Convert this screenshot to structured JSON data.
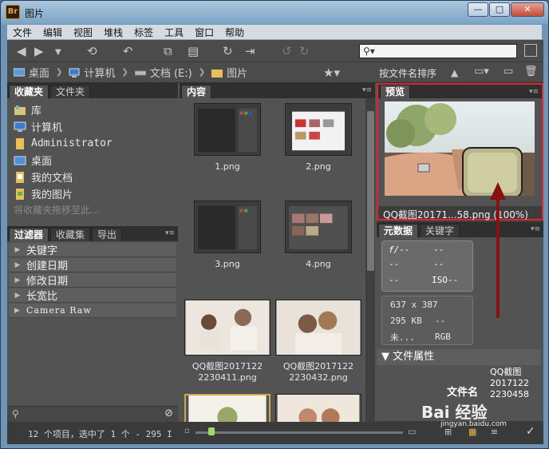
{
  "window": {
    "app_icon_text": "Br",
    "title": "图片",
    "min": "—",
    "max": "□",
    "close": "✕"
  },
  "menu": [
    "文件",
    "编辑",
    "视图",
    "堆栈",
    "标签",
    "工具",
    "窗口",
    "帮助"
  ],
  "search": {
    "placeholder": "",
    "icon": "search-icon"
  },
  "breadcrumb": [
    "桌面",
    "计算机",
    "文档 (E:)",
    "图片"
  ],
  "sort_label": "按文件名排序",
  "left_tabs": [
    "收藏夹",
    "文件夹"
  ],
  "favorites": [
    {
      "label": "库",
      "icon": "library-icon"
    },
    {
      "label": "计算机",
      "icon": "computer-icon"
    },
    {
      "label": "Administrator",
      "icon": "folder-icon"
    },
    {
      "label": "桌面",
      "icon": "desktop-icon"
    },
    {
      "label": "我的文档",
      "icon": "documents-icon"
    },
    {
      "label": "我的图片",
      "icon": "pictures-icon"
    }
  ],
  "favorites_hint": "将收藏夹拖移至此...",
  "filter_tabs": [
    "过滤器",
    "收藏集",
    "导出"
  ],
  "filters": [
    "关键字",
    "创建日期",
    "修改日期",
    "长宽比",
    "Camera Raw"
  ],
  "content_tab": "内容",
  "thumbnails": [
    {
      "label": "1.png"
    },
    {
      "label": "2.png"
    },
    {
      "label": "3.png"
    },
    {
      "label": "4.png"
    },
    {
      "label": "QQ截图2017122\n2230411.png"
    },
    {
      "label": "QQ截图2017122\n2230432.png"
    }
  ],
  "preview_tab": "预览",
  "preview_caption": "QQ截图20171...58.png (100%)",
  "meta_tabs": [
    "元数据",
    "关键字"
  ],
  "camera": {
    "aperture": "f/--",
    "a2": "--",
    "a3": "--",
    "a4": "--",
    "a5": "--",
    "iso": "ISO--"
  },
  "info": {
    "dims": "637 x 387",
    "size": "295 KB",
    "size2": "--",
    "unknown": "未...",
    "mode": "RGB"
  },
  "file_props_header": "文件属性",
  "file_props": {
    "key": "文件名",
    "value": "QQ截图\n2017122\n2230458"
  },
  "status": "12 个项目，选中了 1 个 - 295 I",
  "slider": {
    "value_fraction": 0.06
  },
  "watermark": {
    "main": "Bai 经验",
    "sub": "jingyan.baidu.com"
  }
}
